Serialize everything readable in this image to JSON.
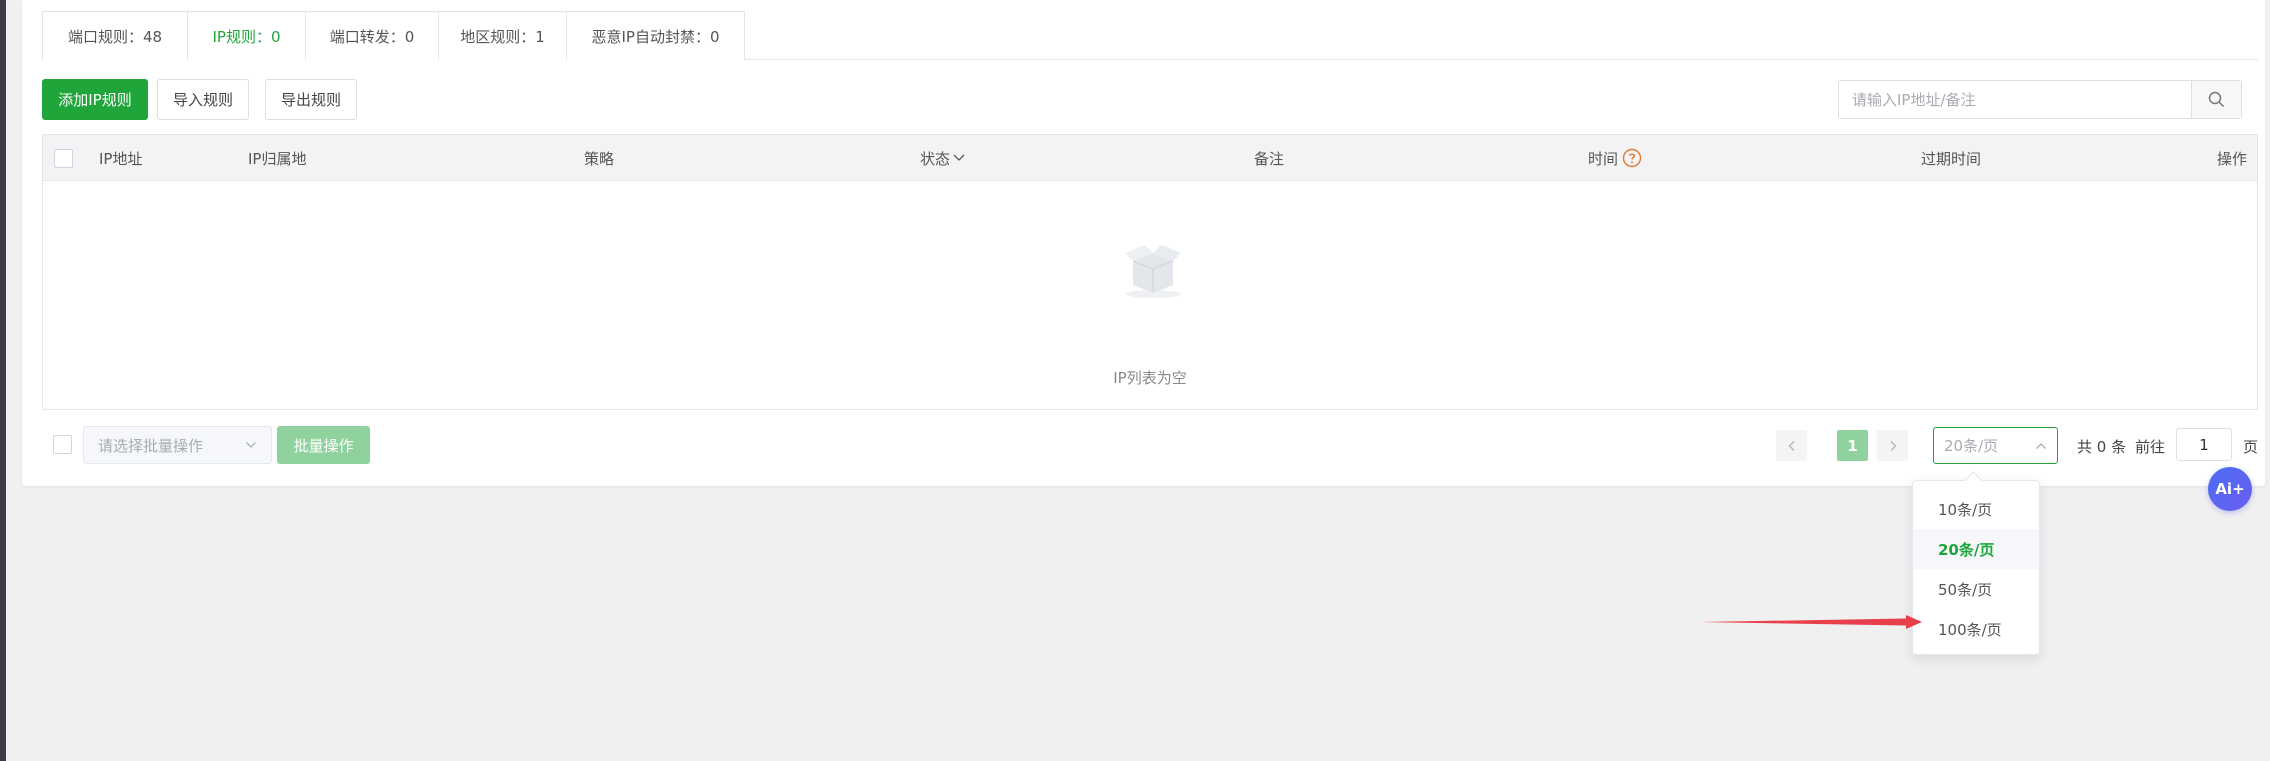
{
  "tabs": [
    {
      "label": "端口规则：48",
      "active": false
    },
    {
      "label": "IP规则：0",
      "active": true
    },
    {
      "label": "端口转发：0",
      "active": false
    },
    {
      "label": "地区规则：1",
      "active": false
    },
    {
      "label": "恶意IP自动封禁：0",
      "active": false
    }
  ],
  "toolbar": {
    "add_label": "添加IP规则",
    "import_label": "导入规则",
    "export_label": "导出规则"
  },
  "search": {
    "placeholder": "请输入IP地址/备注",
    "icon": "search-icon"
  },
  "table": {
    "columns": [
      "IP地址",
      "IP归属地",
      "策略",
      "状态",
      "备注",
      "时间",
      "过期时间",
      "操作"
    ],
    "rows": [],
    "empty_text": "IP列表为空"
  },
  "footer": {
    "batch_placeholder": "请选择批量操作",
    "batch_button": "批量操作",
    "current_page": "1",
    "page_size_label": "20条/页",
    "total_label": "共 0 条",
    "goto_label": "前往",
    "goto_value": "1",
    "page_suffix": "页"
  },
  "page_size_options": [
    {
      "label": "10条/页",
      "selected": false
    },
    {
      "label": "20条/页",
      "selected": true
    },
    {
      "label": "50条/页",
      "selected": false
    },
    {
      "label": "100条/页",
      "selected": false
    }
  ],
  "ai_button": {
    "label": "Ai+"
  },
  "colors": {
    "accent": "#20a53a",
    "accent_disabled": "#90d29d",
    "warning": "#e6772e",
    "annotation": "#e8404a",
    "ai": "#5865f2"
  }
}
